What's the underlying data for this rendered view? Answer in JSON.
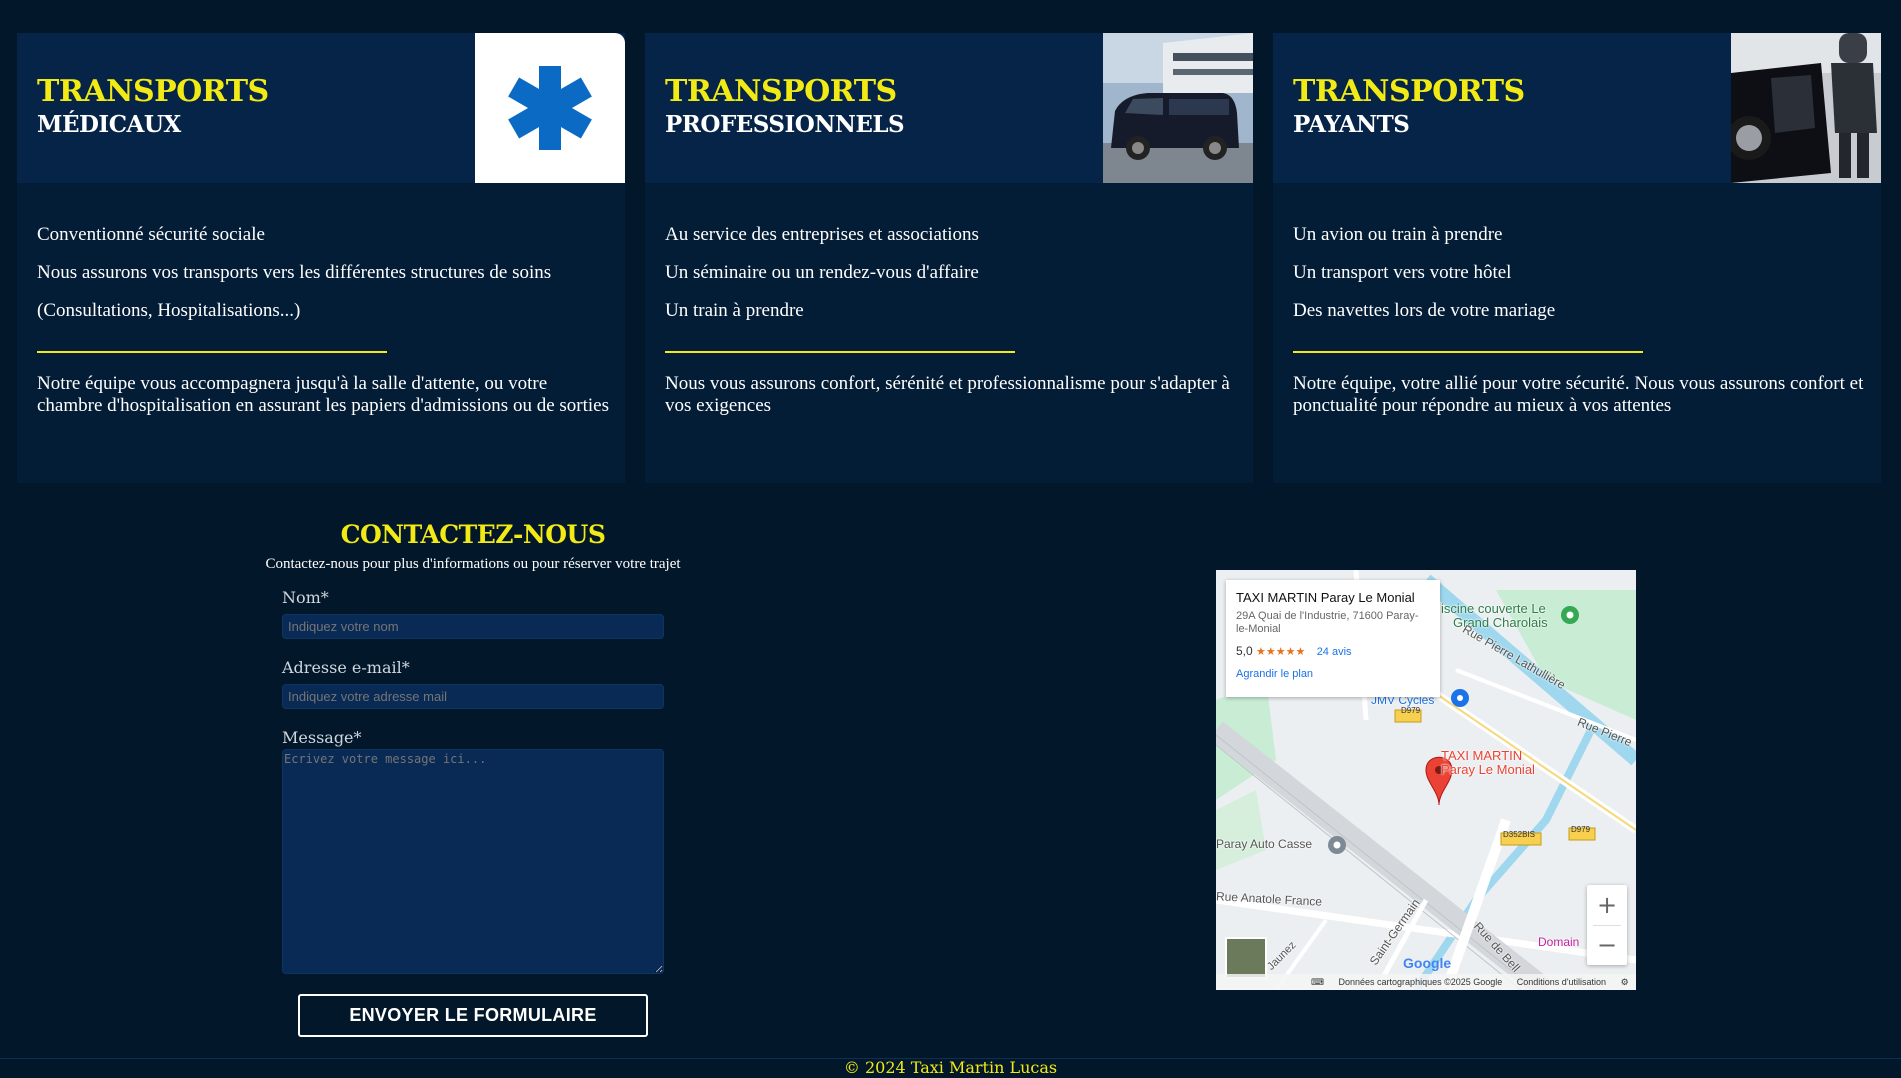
{
  "cards": [
    {
      "title_main": "TRANSPORTS",
      "title_sub": "MÉDICAUX",
      "image": "star-of-life-icon",
      "lines": [
        "Conventionné sécurité sociale",
        "Nous assurons vos transports vers les différentes structures de soins",
        "(Consultations, Hospitalisations...)"
      ],
      "description": "Notre équipe vous accompagnera jusqu'à la salle d'attente, ou votre chambre d'hospitalisation en assurant les papiers d'admissions ou de sorties"
    },
    {
      "title_main": "TRANSPORTS",
      "title_sub": "PROFESSIONNELS",
      "image": "van-photo",
      "lines": [
        "Au service des entreprises et associations",
        "Un séminaire ou un rendez-vous d'affaire",
        "Un train à prendre"
      ],
      "description": "Nous vous assurons confort, sérénité et professionnalisme pour s'adapter à vos exigences"
    },
    {
      "title_main": "TRANSPORTS",
      "title_sub": "PAYANTS",
      "image": "chauffeur-car-photo",
      "lines": [
        "Un avion ou train à prendre",
        "Un transport vers votre hôtel",
        "Des navettes lors de votre mariage"
      ],
      "description": "Notre équipe, votre allié pour votre sécurité. Nous vous assurons confort et ponctualité pour répondre au mieux à vos attentes"
    }
  ],
  "contact": {
    "title": "CONTACTEZ-NOUS",
    "subtitle": "Contactez-nous pour plus d'informations ou pour réserver votre trajet",
    "name_label": "Nom*",
    "name_placeholder": "Indiquez votre nom",
    "email_label": "Adresse e-mail*",
    "email_placeholder": "Indiquez votre adresse mail",
    "message_label": "Message*",
    "message_placeholder": "Ecrivez votre message ici...",
    "submit_label": "ENVOYER LE FORMULAIRE"
  },
  "map": {
    "place_name": "TAXI MARTIN Paray Le Monial",
    "address": "29A Quai de l'Industrie, 71600 Paray-le-Monial",
    "rating": "5,0",
    "stars": "★★★★★",
    "reviews": "24 avis",
    "enlarge": "Agrandir le plan",
    "marker_label_1": "TAXI MARTIN",
    "marker_label_2": "Paray Le Monial",
    "poi_piscine_1": "iscine couverte Le",
    "poi_piscine_2": "Grand Charolais",
    "poi_cycles": "JMV Cycles",
    "poi_casse": "Paray Auto Casse",
    "road_pierre_lath": "Rue Pierre Lathullière",
    "road_pierre": "Rue Pierre",
    "road_anatole": "Rue Anatole France",
    "road_saint_germain": "Saint-Germain",
    "road_bell": "Rue de Bell",
    "road_jaunez": "Jaunez",
    "poi_domain": "Domain",
    "road_d979_a": "D979",
    "road_d979_b": "D979",
    "road_d352": "D352BIS",
    "zoom_in": "+",
    "zoom_out": "−",
    "google": "Google",
    "footer_keyboard": "⌨",
    "footer_data": "Données cartographiques ©2025 Google",
    "footer_terms": "Conditions d'utilisation",
    "colors": {
      "marker": "#ea4335",
      "water": "#9fd8ee",
      "park": "#c8ecd4",
      "road": "#ffffff"
    }
  },
  "footer": {
    "copyright": "© 2024 Taxi Martin Lucas"
  },
  "colors": {
    "background": "#03172a",
    "card": "#041d36",
    "accent": "#f2ea14",
    "input": "#082a55"
  }
}
